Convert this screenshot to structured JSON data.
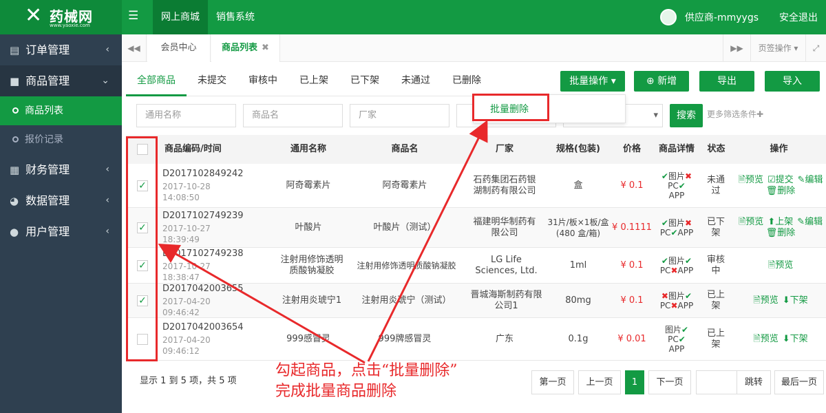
{
  "header": {
    "logo_text": "药械网",
    "logo_url": "www.yaoxie.com",
    "menu_icon": "hamburger-icon",
    "nav": [
      "网上商城",
      "销售系统"
    ],
    "user": "供应商-mmyygs",
    "logout": "安全退出"
  },
  "sidebar": {
    "items": [
      {
        "label": "订单管理",
        "icon": "clipboard-icon"
      },
      {
        "label": "商品管理",
        "icon": "bag-icon"
      },
      {
        "label": "财务管理",
        "icon": "grid-icon"
      },
      {
        "label": "数据管理",
        "icon": "pie-chart-icon"
      },
      {
        "label": "用户管理",
        "icon": "user-icon"
      }
    ],
    "subitems": [
      "商品列表",
      "报价记录"
    ]
  },
  "pagetabs": {
    "tabs": [
      "会员中心",
      "商品列表"
    ],
    "tools_label": "页签操作"
  },
  "status_tabs": [
    "全部商品",
    "未提交",
    "审核中",
    "已上架",
    "已下架",
    "未通过",
    "已删除"
  ],
  "toolbar": {
    "batch": "批量操作",
    "add": "新增",
    "export": "导出",
    "import": "导入",
    "dropdown_item": "批量删除"
  },
  "filters": {
    "generic_name": "通用名称",
    "product_name": "商品名",
    "maker": "厂家",
    "search": "搜索",
    "more": "更多筛选条件"
  },
  "table": {
    "headers": [
      "商品编码/时间",
      "通用名称",
      "商品名",
      "厂家",
      "规格(包装)",
      "价格",
      "商品详情",
      "状态",
      "操作"
    ],
    "rows": [
      {
        "checked": true,
        "code": "D2017102849242",
        "time": "2017-10-28 14:08:50",
        "generic": "阿奇霉素片",
        "name": "阿奇霉素片",
        "maker": "石药集团石药银湖制药有限公司",
        "spec": "盒",
        "price": "¥ 0.1",
        "detail": [
          "✔图片✖",
          "PC✔",
          "APP"
        ],
        "status": "未通过",
        "ops": [
          "预览",
          "提交",
          "编辑",
          "删除"
        ]
      },
      {
        "checked": true,
        "code": "D2017102749239",
        "time": "2017-10-27 18:39:49",
        "generic": "叶酸片",
        "name": "叶酸片（测试）",
        "maker": "福建明华制药有限公司",
        "spec": "31片/板×1板/盒 (480 盒/箱)",
        "price": "¥ 0.1111",
        "detail": [
          "✔图片✖",
          "PC✔APP"
        ],
        "status": "已下架",
        "ops": [
          "预览",
          "上架",
          "编辑",
          "删除"
        ]
      },
      {
        "checked": true,
        "code": "D2017102749238",
        "time": "2017-10-27 18:38:47",
        "generic": "注射用修饰透明质酸钠凝胶",
        "name": "注射用修饰透明质酸钠凝胶",
        "maker": "LG Life Sciences, Ltd.",
        "spec": "1ml",
        "price": "¥ 0.1",
        "detail": [
          "✔图片✔",
          "PC✖APP"
        ],
        "status": "审核中",
        "ops": [
          "预览"
        ]
      },
      {
        "checked": true,
        "code": "D2017042003655",
        "time": "2017-04-20 09:46:42",
        "generic": "注射用炎琥宁1",
        "name": "注射用炎琥宁（测试）",
        "maker": "晋城海斯制药有限公司1",
        "spec": "80mg",
        "price": "¥ 0.1",
        "detail": [
          "✖图片✔",
          "PC✖APP"
        ],
        "status": "已上架",
        "ops": [
          "预览",
          "下架"
        ]
      },
      {
        "checked": false,
        "code": "D2017042003654",
        "time": "2017-04-20 09:46:12",
        "generic": "999感冒灵",
        "name": "999牌感冒灵",
        "maker": "广东",
        "spec": "0.1g",
        "price": "¥ 0.01",
        "detail": [
          "图片✔",
          "PC✔",
          "APP"
        ],
        "status": "已上架",
        "ops": [
          "预览",
          "下架"
        ]
      }
    ]
  },
  "footer": {
    "info": "显示 1 到 5 项，共 5 项",
    "pager": [
      "第一页",
      "上一页",
      "1",
      "下一页",
      "跳转",
      "最后一页"
    ]
  },
  "annotation": {
    "line1": "勾起商品，点击“批量删除”",
    "line2": "完成批量商品删除"
  },
  "colors": {
    "brand": "#139a43",
    "sidebar": "#2f4050",
    "alert": "#e8292b"
  }
}
